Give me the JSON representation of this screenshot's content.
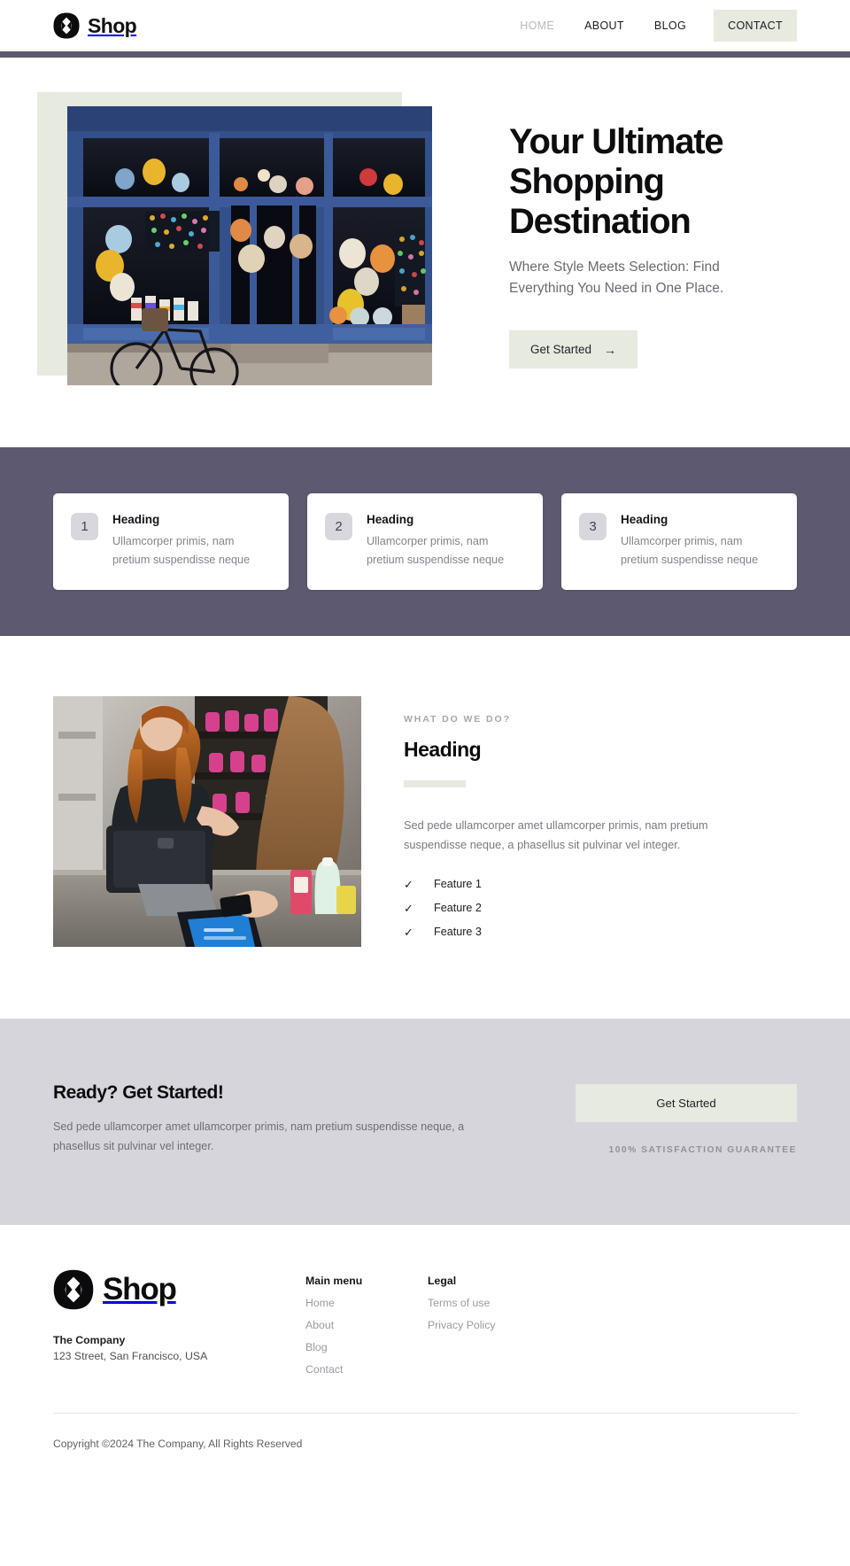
{
  "header": {
    "logo_icon": "shop-logo-icon",
    "brand": "Shop",
    "nav": [
      {
        "label": "HOME",
        "state": "muted"
      },
      {
        "label": "ABOUT",
        "state": "normal"
      },
      {
        "label": "BLOG",
        "state": "normal"
      }
    ],
    "cta_label": "CONTACT",
    "rule_color": "#5d5970"
  },
  "hero": {
    "title": "Your Ultimate Shopping Destination",
    "subtitle": "Where Style Meets Selection: Find Everything You Need in One Place.",
    "button_label": "Get Started",
    "button_arrow": "→",
    "accent_color": "#e6eadf",
    "image_alt": "blue shop storefront with hanging lamps and a bicycle"
  },
  "cards_band": {
    "background": "#5d5970",
    "cards": [
      {
        "number": "1",
        "heading": "Heading",
        "text": "Ullamcorper primis, nam pretium suspendisse neque"
      },
      {
        "number": "2",
        "heading": "Heading",
        "text": "Ullamcorper primis, nam pretium suspendisse neque"
      },
      {
        "number": "3",
        "heading": "Heading",
        "text": "Ullamcorper primis, nam pretium suspendisse neque"
      }
    ]
  },
  "about": {
    "eyebrow": "WHAT DO WE DO?",
    "title": "Heading",
    "paragraph": "Sed pede ullamcorper amet ullamcorper primis, nam pretium suspendisse neque, a phasellus sit pulvinar vel integer.",
    "features": [
      {
        "check": "✓",
        "label": "Feature 1"
      },
      {
        "check": "✓",
        "label": "Feature 2"
      },
      {
        "check": "✓",
        "label": "Feature 3"
      }
    ],
    "image_alt": "shopkeeper and customer at a checkout counter with a card reader"
  },
  "cta": {
    "background": "#d6d5db",
    "title": "Ready? Get Started!",
    "paragraph": "Sed pede ullamcorper amet ullamcorper primis, nam pretium suspendisse neque, a phasellus sit pulvinar vel integer.",
    "button_label": "Get Started",
    "guarantee": "100% SATISFACTION GUARANTEE"
  },
  "footer": {
    "logo_icon": "shop-logo-icon",
    "brand": "Shop",
    "company": "The Company",
    "address": "123 Street, San Francisco, USA",
    "columns": [
      {
        "title": "Main menu",
        "links": [
          "Home",
          "About",
          "Blog",
          "Contact"
        ]
      },
      {
        "title": "Legal",
        "links": [
          "Terms of use",
          "Privacy Policy"
        ]
      }
    ],
    "copyright": "Copyright ©2024 The Company, All Rights Reserved"
  }
}
